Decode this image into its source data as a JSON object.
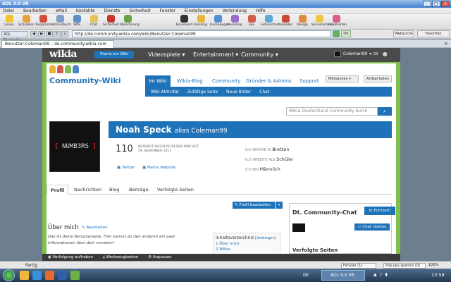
{
  "window": {
    "title": "AOL 9.0 VR"
  },
  "menu": [
    "Datei",
    "Bearbeiten",
    "eMail",
    "Kontakte",
    "Dienste",
    "Sicherheit",
    "Fenster",
    "Einstellungen",
    "Verbindung",
    "Hilfe"
  ],
  "toolbar": {
    "left": [
      "Lesen",
      "Schreiben",
      "Telegramm",
      "Adressbuch",
      "SMS",
      "Chat",
      "Sicherheit",
      "Abrechnung"
    ],
    "right": [
      "Boulevard",
      "Banking",
      "Homepages",
      "Horoskop",
      "Fax",
      "Fotocenter",
      "Kalender",
      "Design",
      "Sonnenstand",
      "Grußkarten"
    ]
  },
  "address": {
    "start_label": "AOL Startseite",
    "url": "http://de.community.wikia.com/wiki/Benutzer:Coleman99",
    "ok": "OK",
    "webbutton": "Websuche",
    "fav": "Favoriten"
  },
  "tab": {
    "title": "Benutzer:Coleman99 – de.community.wikia.com"
  },
  "wikia": {
    "logo": "wikia",
    "start_wiki": "Starte ein Wiki",
    "nav": [
      "Videospiele",
      "Entertainment",
      "Community"
    ],
    "username": "Coleman99"
  },
  "wiki": {
    "logo_text": "Community-Wiki",
    "tabs": [
      "Im Wiki",
      "Wikia-Blog",
      "Community",
      "Gründer & Admins",
      "Support"
    ],
    "subnav": [
      "Wiki-Aktivität",
      "Zufällige Seite",
      "Neue Bilder",
      "Chat"
    ],
    "mitmachen": "Mitmachen",
    "teilen": "Artikel teilen",
    "search_placeholder": "Wikia Deutschland Community durch"
  },
  "profile": {
    "avatar_text_a": "[ ",
    "avatar_text_b": "NUMB3RS",
    "avatar_text_c": " ]",
    "name": "Noah Speck",
    "alias": "alias Coleman99",
    "edit_count": "110",
    "edit_label": "BEARBEITUNGEN IN DIESEM WIKI SEIT",
    "edit_date": "29. NOVEMBER 2011",
    "twitter": "Twitter",
    "website": "Meine Website",
    "lives_label": "ICH WOHNE IN",
    "lives": "Bretten",
    "works_label": "ICH ARBEITE ALS",
    "works": "Schüler",
    "is_label": "ICH BIN",
    "is": "Männlich",
    "tabs": [
      "Profil",
      "Nachrichten",
      "Blog",
      "Beiträge",
      "Verfolgte Seiten"
    ],
    "edit_profile": "Profil bearbeiten"
  },
  "about": {
    "title": "Über mich",
    "edit": "Bearbeiten",
    "text": "Das ist deine Benutzerseite. Hier kannst du den anderen ein paar Informationen über dich verraten!"
  },
  "toc": {
    "title": "Inhaltsverzeichnis",
    "hide": "[Verbergen]",
    "items": [
      "1 Über mich",
      "2 Wikia"
    ]
  },
  "chat": {
    "title": "Dt. Community-Chat",
    "live": "In Echtzeit!",
    "start": "Chat starten",
    "followed": "Verfolgte Seiten"
  },
  "wikia_bottom": [
    "Verfolgung aufheben",
    "Werkzeugkasten",
    "Anpassen"
  ],
  "status": {
    "text": "Fertig",
    "window": "Fenster (1)",
    "popups": "Pop-ups sperren (0)",
    "zoom": "100%"
  },
  "taskbar": {
    "app": "AOL 9.0 VR",
    "lang": "DE",
    "time": "13:58"
  },
  "colors": {
    "wikia_blue": "#1e72b8",
    "wikia_green": "#7fc14a",
    "wikia_dark": "#4a4a4a"
  }
}
